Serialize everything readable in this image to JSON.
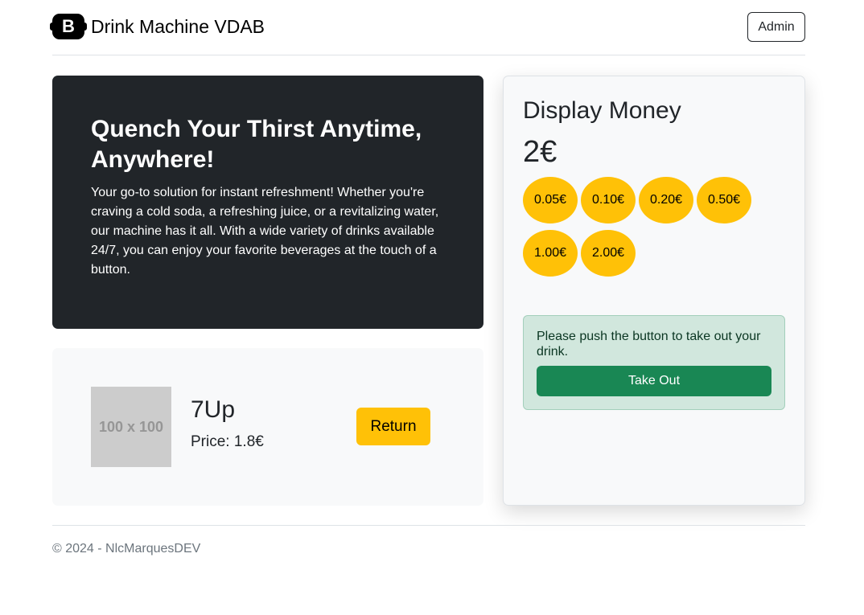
{
  "header": {
    "logo_letter": "B",
    "title": "Drink Machine VDAB",
    "admin_label": "Admin"
  },
  "hero": {
    "heading": "Quench Your Thirst Anytime, Anywhere!",
    "text": "Your go-to solution for instant refreshment! Whether you're craving a cold soda, a refreshing juice, or a revitalizing water, our machine has it all. With a wide variety of drinks available 24/7, you can enjoy your favorite beverages at the touch of a button."
  },
  "product": {
    "image_placeholder": "100 x 100",
    "name": "7Up",
    "price": "Price: 1.8€",
    "return_label": "Return"
  },
  "money": {
    "title": "Display Money",
    "amount": "2€",
    "coins": [
      "0.05€",
      "0.10€",
      "0.20€",
      "0.50€",
      "1.00€",
      "2.00€"
    ],
    "alert_message": "Please push the button to take out your drink.",
    "takeout_label": "Take Out"
  },
  "footer": {
    "text": "© 2024 - NlcMarquesDEV"
  },
  "colors": {
    "dark": "#212529",
    "coin": "#ffc107",
    "success": "#198754",
    "alert_bg": "#d1e7dd"
  }
}
